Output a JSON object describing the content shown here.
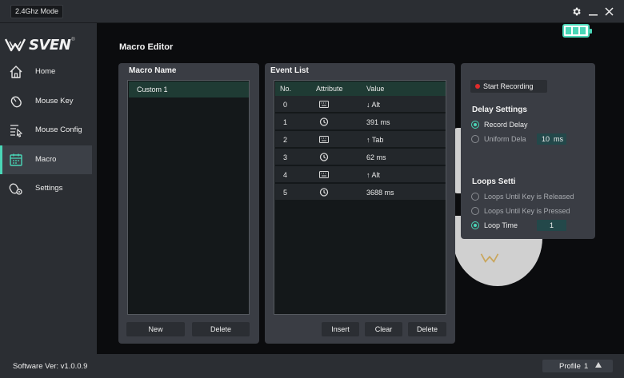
{
  "titlebar": {
    "mode": "2.4Ghz Mode"
  },
  "brand": {
    "name": "SVEN",
    "reg": "®"
  },
  "sidebar": {
    "items": [
      {
        "label": "Home",
        "icon": "home-icon"
      },
      {
        "label": "Mouse Key",
        "icon": "mouse-icon"
      },
      {
        "label": "Mouse Config",
        "icon": "sliders-icon"
      },
      {
        "label": "Macro",
        "icon": "calendar-icon",
        "active": true
      },
      {
        "label": "Settings",
        "icon": "gear-mouse-icon"
      }
    ]
  },
  "page": {
    "title": "Macro Editor"
  },
  "battery": {
    "level_bars": 3,
    "max_bars": 3,
    "color": "#4ad6b7"
  },
  "macro_panel": {
    "title": "Macro Name",
    "items": [
      "Custom 1"
    ],
    "new_label": "New",
    "delete_label": "Delete"
  },
  "event_panel": {
    "title": "Event List",
    "columns": [
      "No.",
      "Attribute",
      "Value"
    ],
    "rows": [
      {
        "no": "0",
        "attr": "keyboard",
        "value": "↓ Alt"
      },
      {
        "no": "1",
        "attr": "clock",
        "value": "391 ms"
      },
      {
        "no": "2",
        "attr": "keyboard",
        "value": "↑ Tab"
      },
      {
        "no": "3",
        "attr": "clock",
        "value": "62 ms"
      },
      {
        "no": "4",
        "attr": "keyboard",
        "value": "↑ Alt"
      },
      {
        "no": "5",
        "attr": "clock",
        "value": "3688 ms"
      }
    ],
    "insert_label": "Insert",
    "clear_label": "Clear",
    "delete_label": "Delete"
  },
  "settings_panel": {
    "record_label": "Start Recording",
    "delay_title": "Delay Settings",
    "record_delay_label": "Record Delay",
    "uniform_delay_label": "Uniform Dela",
    "uniform_delay_value": "10",
    "uniform_delay_unit": "ms",
    "loops_title": "Loops Setti",
    "loop_released_label": "Loops Until Key is Released",
    "loop_pressed_label": "Loops Until Key is Pressed",
    "loop_time_label": "Loop Time",
    "loop_time_value": "1"
  },
  "footer": {
    "version": "Software Ver: v1.0.0.9",
    "profile_label": "Profile",
    "profile_number": "1"
  },
  "colors": {
    "accent": "#4ad6b7",
    "record": "#e02b2b"
  }
}
